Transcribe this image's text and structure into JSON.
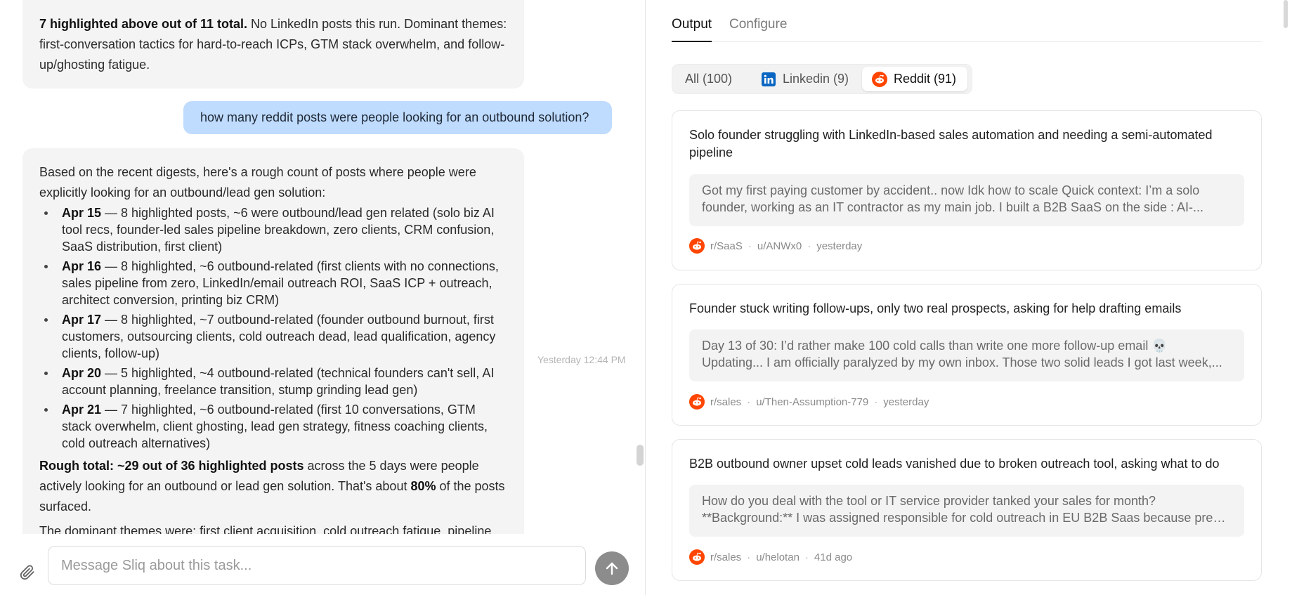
{
  "chat": {
    "top_bubble": {
      "bold": "7 highlighted above out of 11 total.",
      "text": " No LinkedIn posts this run. Dominant themes: first-conversation tactics for hard-to-reach ICPs, GTM stack overwhelm, and follow-up/ghosting fatigue."
    },
    "user_message": "how many reddit posts were people looking for an outbound solution?",
    "timestamp": "Yesterday 12:44 PM",
    "reply": {
      "intro": "Based on the recent digests, here's a rough count of posts where people were explicitly looking for an outbound/lead gen solution:",
      "items": [
        {
          "date": "Apr 15",
          "text": " — 8 highlighted posts, ~6 were outbound/lead gen related (solo biz AI tool recs, founder-led sales pipeline breakdown, zero clients, CRM confusion, SaaS distribution, first client)"
        },
        {
          "date": "Apr 16",
          "text": " — 8 highlighted, ~6 outbound-related (first clients with no connections, sales pipeline from zero, LinkedIn/email outreach ROI, SaaS ICP + outreach, architect conversion, printing biz CRM)"
        },
        {
          "date": "Apr 17",
          "text": " — 8 highlighted, ~7 outbound-related (founder outbound burnout, first customers, outsourcing clients, cold outreach dead, lead qualification, agency clients, follow-up)"
        },
        {
          "date": "Apr 20",
          "text": " — 5 highlighted, ~4 outbound-related (technical founders can't sell, AI account planning, freelance transition, stump grinding lead gen)"
        },
        {
          "date": "Apr 21",
          "text": " — 7 highlighted, ~6 outbound-related (first 10 conversations, GTM stack overwhelm, client ghosting, lead gen strategy, fitness coaching clients, cold outreach alternatives)"
        }
      ],
      "total_bold": "Rough total: ~29 out of 36 highlighted posts",
      "total_text_1": " across the 5 days were people actively looking for an outbound or lead gen solution. That's about ",
      "total_pct": "80%",
      "total_text_2": " of the posts surfaced.",
      "last_line": "The dominant themes were: first client acquisition, cold outreach fatigue, pipeline"
    },
    "input": {
      "placeholder": "Message Sliq about this task...",
      "value": ""
    }
  },
  "output": {
    "tabs": [
      {
        "label": "Output",
        "active": true
      },
      {
        "label": "Configure",
        "active": false
      }
    ],
    "filters": [
      {
        "label": "All (100)",
        "active": false
      },
      {
        "label": "Linkedin (9)",
        "active": false,
        "icon": "linkedin-icon"
      },
      {
        "label": "Reddit (91)",
        "active": true,
        "icon": "reddit-icon"
      }
    ],
    "cards": [
      {
        "title": "Solo founder struggling with LinkedIn-based sales automation and needing a semi-automated pipeline",
        "snippet_1": "Got my first paying customer by accident.. now Idk how to scale Quick context: I’m a solo",
        "snippet_2": "founder, working as an IT contractor as my main job. I built a B2B SaaS on the side : AI-...",
        "subreddit": "r/SaaS",
        "user": "u/ANWx0",
        "time": "yesterday"
      },
      {
        "title": "Founder stuck writing follow-ups, only two real prospects, asking for help drafting emails",
        "snippet_1": "Day 13 of 30: I’d rather make 100 cold calls than write one more follow-up email 💀",
        "snippet_2": "Updating... I am officially paralyzed by my own inbox. Those two solid leads I got last week,...",
        "subreddit": "r/sales",
        "user": "u/Then-Assumption-779",
        "time": "yesterday"
      },
      {
        "title": "B2B outbound owner upset cold leads vanished due to broken outreach tool, asking what to do",
        "snippet_1": "How do you deal with the tool or IT service provider tanked your sales for month?",
        "snippet_2": "**Background:** I was assigned responsible for cold outreach in EU B2B Saas because previo...",
        "subreddit": "r/sales",
        "user": "u/helotan",
        "time": "41d ago"
      }
    ],
    "colors": {
      "reddit": "#ff4500",
      "linkedin": "#0a66c2",
      "user_bubble": "#bfdbfe",
      "ai_bubble": "#f4f4f4"
    }
  }
}
